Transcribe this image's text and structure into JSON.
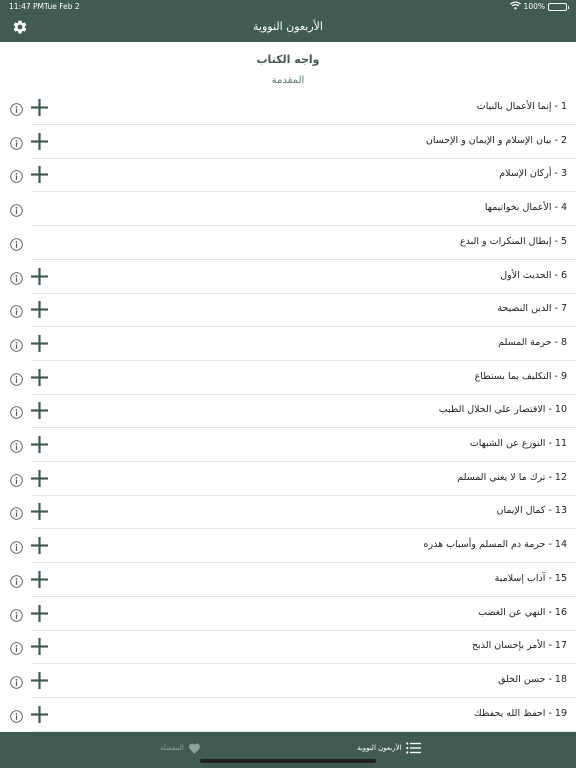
{
  "status_bar": {
    "time": "11:47 PM",
    "date": "Tue Feb 2",
    "battery": "100%"
  },
  "nav": {
    "title": "الأربعون النووية",
    "settings_icon": "gear-icon"
  },
  "section": {
    "title": "واجه الكتاب",
    "subtitle": "المقدمة"
  },
  "hadith_list": [
    {
      "label": "1 - إنما الأعمال بالنيات",
      "has_add": true
    },
    {
      "label": "2 - بيان الإسلام و الإيمان و الإحسان",
      "has_add": true
    },
    {
      "label": "3 - أركان الإسلام",
      "has_add": true
    },
    {
      "label": "4 - الأعمال بخواتيمها",
      "has_add": false
    },
    {
      "label": "5 - إبطال المنكرات و البدع",
      "has_add": false
    },
    {
      "label": "6 - الحديث الأول",
      "has_add": true
    },
    {
      "label": "7 - الدين النصيحة",
      "has_add": true
    },
    {
      "label": "8 - حرمة المسلم",
      "has_add": true
    },
    {
      "label": "9 - التكليف بما يستطاع",
      "has_add": true
    },
    {
      "label": "10 - الاقتصار علي الحلال الطيب",
      "has_add": true
    },
    {
      "label": "11 - التورع عن الشبهات",
      "has_add": true
    },
    {
      "label": "12 - ترك ما لا يعني المسلم",
      "has_add": true
    },
    {
      "label": "13 - كمال الإيمان",
      "has_add": true
    },
    {
      "label": "14 - حرمة دم المسلم وأسباب هدره",
      "has_add": true
    },
    {
      "label": "15 - آداب إسلامية",
      "has_add": true
    },
    {
      "label": "16 - النهي عن الغضب",
      "has_add": true
    },
    {
      "label": "17 - الأمر بإحسان الذبح",
      "has_add": true
    },
    {
      "label": "18 - حسن الخلق",
      "has_add": true
    },
    {
      "label": "19 - احفظ الله يحفظك",
      "has_add": true
    }
  ],
  "tabs": [
    {
      "label": "الأربعون النووية",
      "icon": "list-icon",
      "active": true
    },
    {
      "label": "المفضلة",
      "icon": "heart-icon",
      "active": false
    }
  ],
  "colors": {
    "accent": "#3f5b53",
    "text": "#222222",
    "divider": "#e2e2e2"
  }
}
